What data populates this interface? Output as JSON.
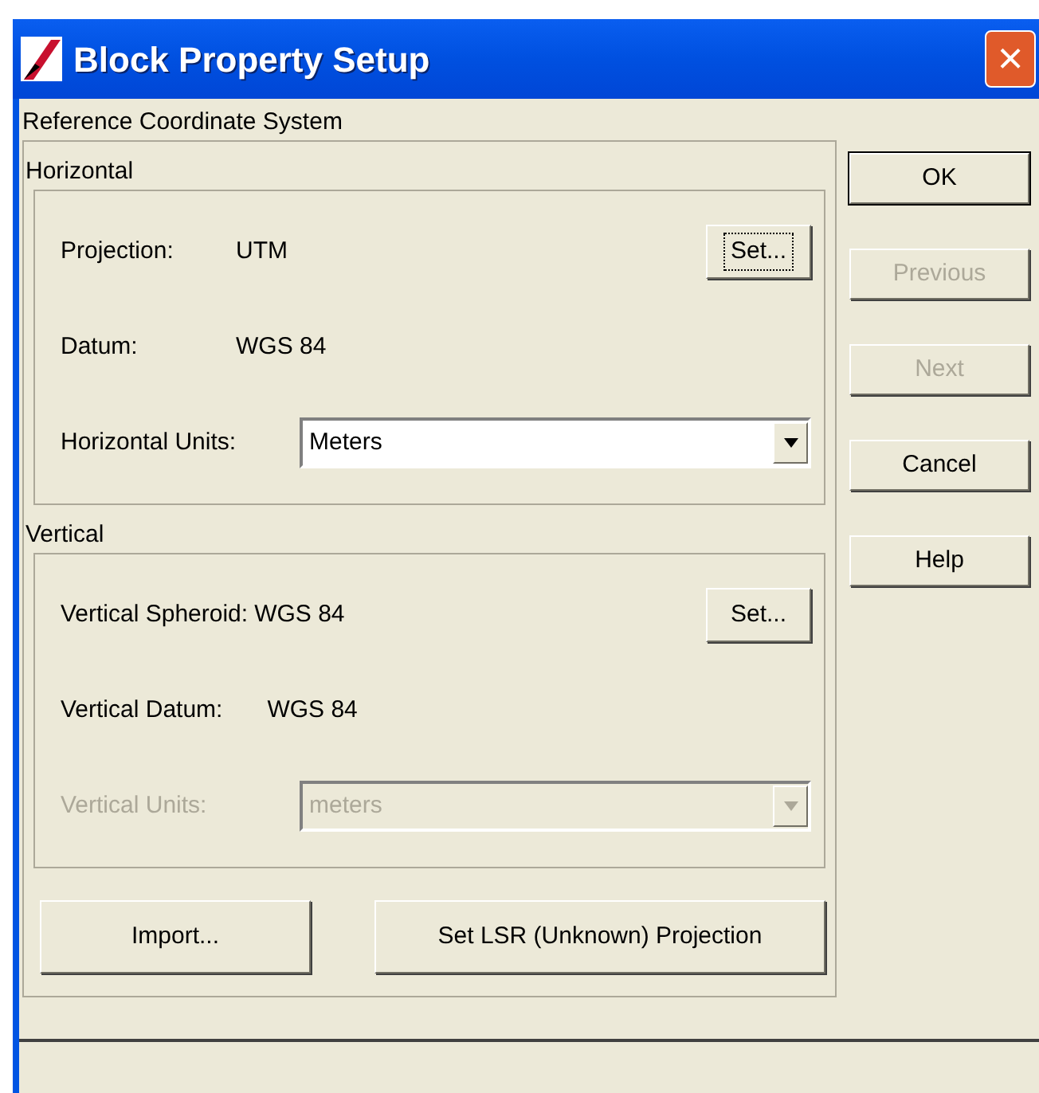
{
  "window": {
    "title": "Block Property Setup",
    "close": "×"
  },
  "section_label": "Reference Coordinate System",
  "groups": [
    {
      "label": "Horizontal",
      "rows": [
        {
          "kind": "value",
          "label": "Projection:",
          "value": "UTM",
          "button": {
            "label": "Set...",
            "focused": true
          }
        },
        {
          "kind": "value",
          "label": "Datum:",
          "value": "WGS 84"
        },
        {
          "kind": "select",
          "label": "Horizontal Units:",
          "value": "Meters",
          "disabled": false
        }
      ]
    },
    {
      "label": "Vertical",
      "rows": [
        {
          "kind": "value",
          "label": "Vertical Spheroid:",
          "value": "WGS 84",
          "button": {
            "label": "Set...",
            "focused": false
          }
        },
        {
          "kind": "value",
          "label": "Vertical Datum:",
          "value": "WGS 84"
        },
        {
          "kind": "select",
          "label": "Vertical Units:",
          "value": "meters",
          "disabled": true
        }
      ]
    }
  ],
  "bottom_buttons": [
    {
      "label": "Import..."
    },
    {
      "label": "Set LSR (Unknown) Projection"
    }
  ],
  "side_buttons": [
    {
      "label": "OK",
      "disabled": false,
      "default": true
    },
    {
      "label": "Previous",
      "disabled": true,
      "default": false
    },
    {
      "label": "Next",
      "disabled": true,
      "default": false
    },
    {
      "label": "Cancel",
      "disabled": false,
      "default": false
    },
    {
      "label": "Help",
      "disabled": false,
      "default": false
    }
  ]
}
